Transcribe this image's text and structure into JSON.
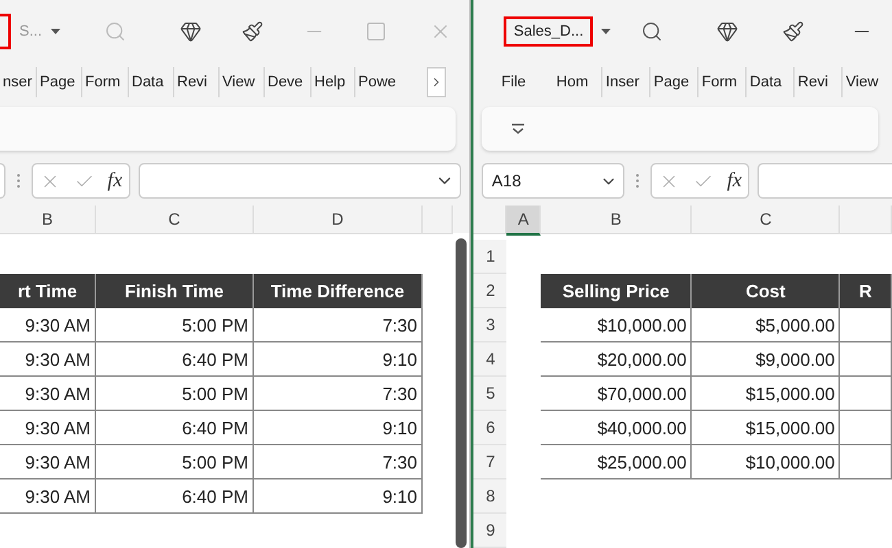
{
  "left_window": {
    "title": "S...",
    "tabs": [
      {
        "label": "nser"
      },
      {
        "label": "Page"
      },
      {
        "label": "Form"
      },
      {
        "label": "Data"
      },
      {
        "label": "Revi"
      },
      {
        "label": "View"
      },
      {
        "label": "Deve"
      },
      {
        "label": "Help"
      },
      {
        "label": "Powe"
      }
    ],
    "function_label": "fx",
    "column_headers": [
      {
        "label": "B",
        "selected": false
      },
      {
        "label": "C",
        "selected": false
      },
      {
        "label": "D",
        "selected": false
      }
    ],
    "table": {
      "columns": [
        "rt Time",
        "Finish Time",
        "Time Difference"
      ],
      "rows": [
        [
          "9:30 AM",
          "5:00 PM",
          "7:30"
        ],
        [
          "9:30 AM",
          "6:40 PM",
          "9:10"
        ],
        [
          "9:30 AM",
          "5:00 PM",
          "7:30"
        ],
        [
          "9:30 AM",
          "6:40 PM",
          "9:10"
        ],
        [
          "9:30 AM",
          "5:00 PM",
          "7:30"
        ],
        [
          "9:30 AM",
          "6:40 PM",
          "9:10"
        ]
      ]
    }
  },
  "right_window": {
    "title": "Sales_D...",
    "tabs": [
      {
        "label": "File"
      },
      {
        "label": "Hom"
      },
      {
        "label": "Inser"
      },
      {
        "label": "Page"
      },
      {
        "label": "Form"
      },
      {
        "label": "Data"
      },
      {
        "label": "Revi"
      },
      {
        "label": "View"
      }
    ],
    "name_box": "A18",
    "function_label": "fx",
    "column_headers": [
      {
        "label": "A",
        "selected": true
      },
      {
        "label": "B",
        "selected": false
      },
      {
        "label": "C",
        "selected": false
      }
    ],
    "row_numbers": [
      "1",
      "2",
      "3",
      "4",
      "5",
      "6",
      "7",
      "8",
      "9"
    ],
    "table": {
      "columns": [
        "Selling Price",
        "Cost",
        "R"
      ],
      "rows": [
        [
          "$10,000.00",
          "$5,000.00",
          ""
        ],
        [
          "$20,000.00",
          "$9,000.00",
          ""
        ],
        [
          "$70,000.00",
          "$15,000.00",
          ""
        ],
        [
          "$40,000.00",
          "$15,000.00",
          ""
        ],
        [
          "$25,000.00",
          "$10,000.00",
          ""
        ]
      ]
    }
  }
}
